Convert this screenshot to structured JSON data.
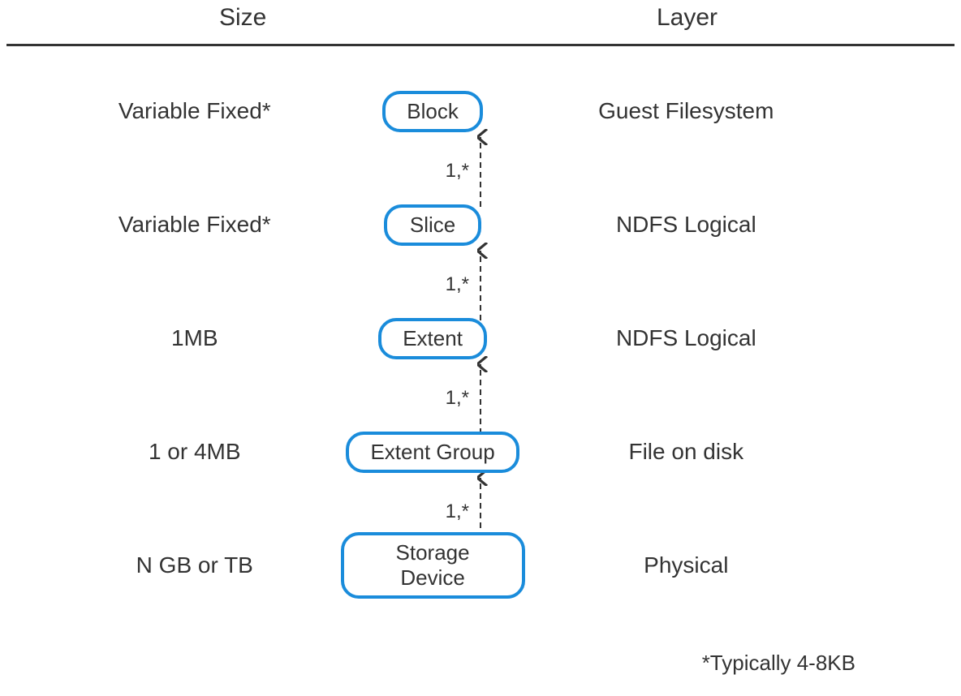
{
  "header": {
    "size_col": "Size",
    "layer_col": "Layer"
  },
  "rows": [
    {
      "size": "Variable Fixed*",
      "node": "Block",
      "layer": "Guest Filesystem"
    },
    {
      "size": "Variable Fixed*",
      "node": "Slice",
      "layer": "NDFS Logical"
    },
    {
      "size": "1MB",
      "node": "Extent",
      "layer": "NDFS Logical"
    },
    {
      "size": "1 or 4MB",
      "node": "Extent Group",
      "layer": "File on disk"
    },
    {
      "size": "N GB or TB",
      "node": "Storage Device",
      "layer": "Physical"
    }
  ],
  "arrow_label": "1,*",
  "footnote": "*Typically 4-8KB",
  "colors": {
    "node_border": "#1a8cdb",
    "text": "#333333",
    "arrow": "#333333"
  }
}
